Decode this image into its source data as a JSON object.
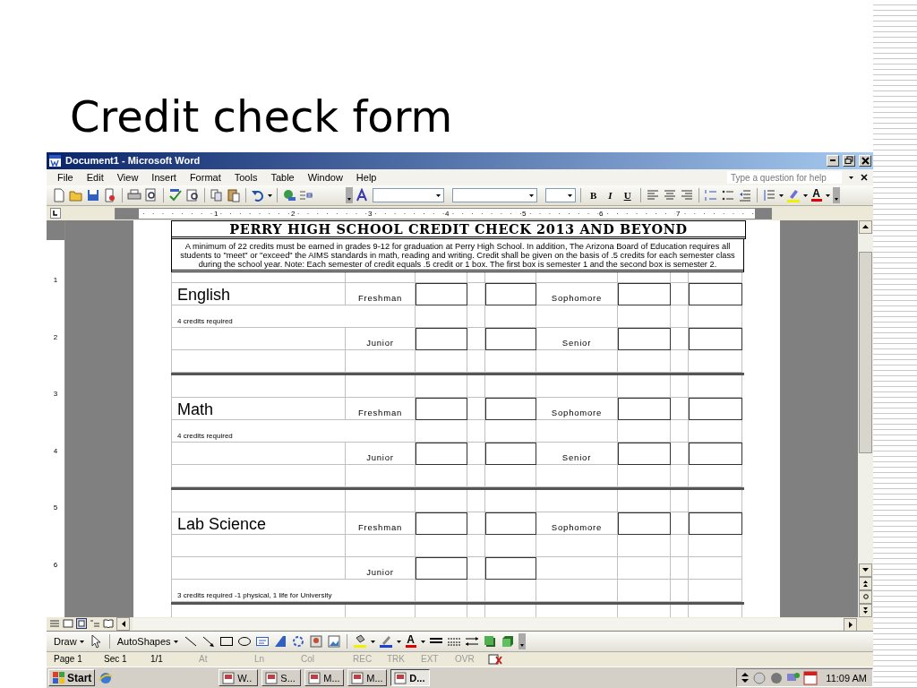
{
  "slide": {
    "title": "Credit check form"
  },
  "window": {
    "title": "Document1 - Microsoft Word"
  },
  "menu": [
    "File",
    "Edit",
    "View",
    "Insert",
    "Format",
    "Tools",
    "Table",
    "Window",
    "Help"
  ],
  "help_box": {
    "placeholder": "Type a question for help"
  },
  "format_toolbar": {
    "bold": "B",
    "italic": "I",
    "underline": "U",
    "font_color": "A"
  },
  "ruler": {
    "numbers": [
      "1",
      "2",
      "3",
      "4",
      "5",
      "6",
      "7"
    ]
  },
  "vertical_ruler": {
    "numbers": [
      "1",
      "2",
      "3",
      "4",
      "5",
      "6"
    ]
  },
  "document": {
    "heading": "PERRY HIGH SCHOOL CREDIT CHECK 2013 AND BEYOND",
    "intro": "A minimum of 22 credits must be earned in grades 9-12 for graduation at Perry High School.  In addition, The Arizona Board of Education requires all students to \"meet\" or \"exceed\" the AIMS standards in math, reading and writing.  Credit shall be given on the basis of .5 credits for each semester class during the school year.  Note:  Each semester of credit equals .5 credit or 1 box.  The first box is semester 1 and the second box is semester 2.",
    "sections": [
      {
        "rows": [
          {
            "kind": "blank"
          },
          {
            "kind": "subject",
            "subject": "English",
            "left": "Freshman",
            "right": "Sophomore"
          },
          {
            "kind": "note",
            "note": "4 credits required"
          },
          {
            "kind": "levels",
            "left": "Junior",
            "right": "Senior"
          },
          {
            "kind": "blank"
          }
        ]
      },
      {
        "rows": [
          {
            "kind": "blank"
          },
          {
            "kind": "subject",
            "subject": "Math",
            "left": "Freshman",
            "right": "Sophomore"
          },
          {
            "kind": "note",
            "note": "4 credits required"
          },
          {
            "kind": "levels",
            "left": "Junior",
            "right": "Senior"
          },
          {
            "kind": "blank"
          }
        ]
      },
      {
        "rows": [
          {
            "kind": "blank"
          },
          {
            "kind": "subject",
            "subject": "Lab Science",
            "left": "Freshman",
            "right": "Sophomore"
          },
          {
            "kind": "blank"
          },
          {
            "kind": "levels",
            "left": "Junior"
          },
          {
            "kind": "note",
            "note": "3 credits required -1 physical, 1 life for University"
          }
        ]
      },
      {
        "rows": [
          {
            "kind": "blank"
          }
        ]
      }
    ]
  },
  "drawing_toolbar": {
    "draw": "Draw",
    "autoshapes": "AutoShapes",
    "font_color": "A"
  },
  "status_bar": [
    {
      "text": "Page 1",
      "disabled": false
    },
    {
      "text": "Sec 1",
      "disabled": false
    },
    {
      "text": "1/1",
      "disabled": false
    },
    {
      "text": "At",
      "disabled": true
    },
    {
      "text": "Ln",
      "disabled": true
    },
    {
      "text": "Col",
      "disabled": true
    },
    {
      "text": "REC",
      "disabled": true
    },
    {
      "text": "TRK",
      "disabled": true
    },
    {
      "text": "EXT",
      "disabled": true
    },
    {
      "text": "OVR",
      "disabled": true
    }
  ],
  "taskbar": {
    "start": "Start",
    "buttons": [
      {
        "label": "W..",
        "selected": false
      },
      {
        "label": "S...",
        "selected": false
      },
      {
        "label": "M...",
        "selected": false
      },
      {
        "label": "M...",
        "selected": false
      },
      {
        "label": "D...",
        "selected": true
      }
    ],
    "clock": "11:09 AM"
  }
}
